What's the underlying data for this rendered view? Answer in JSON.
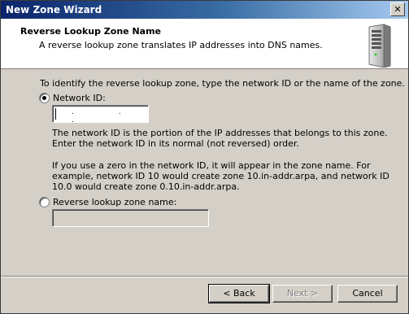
{
  "window": {
    "title": "New Zone Wizard",
    "close_glyph": "✕"
  },
  "header": {
    "title": "Reverse Lookup Zone Name",
    "subtitle": "A reverse lookup zone translates IP addresses into DNS names.",
    "icon": "server-icon"
  },
  "body": {
    "intro": "To identify the reverse lookup zone, type the network ID or the name of the zone.",
    "option_network_id": {
      "label": "Network ID:",
      "selected": true,
      "value": ". . ."
    },
    "network_help_1": "The network ID is the portion of the IP addresses that belongs to this zone. Enter the network ID in its normal (not reversed) order.",
    "network_help_2": "If you use a zero in the network ID, it will appear in the zone name. For example, network ID 10 would create zone 10.in-addr.arpa, and network ID 10.0 would create zone 0.10.in-addr.arpa.",
    "option_zone_name": {
      "label": "Reverse lookup zone name:",
      "selected": false,
      "value": ""
    }
  },
  "buttons": {
    "back": "< Back",
    "next": "Next >",
    "cancel": "Cancel"
  }
}
